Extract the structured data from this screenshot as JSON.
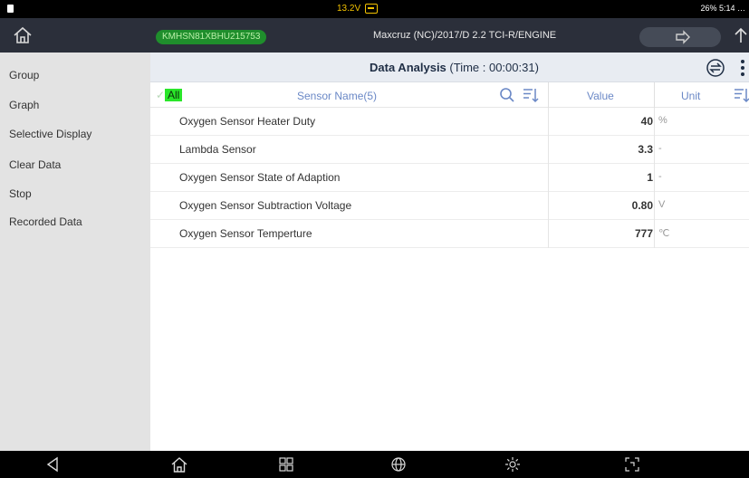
{
  "status_bar": {
    "voltage": "13.2V",
    "right_text": "26% 5:14 …"
  },
  "title_bar": {
    "vin": "KMHSN81XBHU215753",
    "vehicle": "Maxcruz (NC)/2017/D 2.2 TCI-R/ENGINE"
  },
  "sidebar": {
    "items": [
      {
        "label": "Group"
      },
      {
        "label": "Graph"
      },
      {
        "label": "Selective Display"
      },
      {
        "label": "Clear Data"
      },
      {
        "label": "Stop"
      },
      {
        "label": "Recorded Data"
      }
    ]
  },
  "panel": {
    "title": "Data Analysis",
    "time": "(Time : 00:00:31)"
  },
  "table": {
    "check_all_label": "All",
    "headers": {
      "name": "Sensor Name(5)",
      "value": "Value",
      "unit": "Unit"
    },
    "rows": [
      {
        "name": "Oxygen Sensor Heater Duty",
        "value": "40",
        "unit": "%"
      },
      {
        "name": "Lambda Sensor",
        "value": "3.3",
        "unit": "-"
      },
      {
        "name": "Oxygen Sensor State of Adaption",
        "value": "1",
        "unit": "-"
      },
      {
        "name": "Oxygen Sensor Subtraction Voltage",
        "value": "0.80",
        "unit": "V"
      },
      {
        "name": "Oxygen Sensor Temperture",
        "value": "777",
        "unit": "℃"
      }
    ]
  },
  "icons": {
    "home": "home-icon",
    "next": "arrow-right-icon",
    "upload": "upload-icon",
    "swap": "swap-icon",
    "menu": "more-vertical-icon",
    "search": "search-icon",
    "sort": "sort-icon",
    "nav_back": "back-icon",
    "nav_home": "home-icon",
    "nav_apps": "apps-icon",
    "nav_browser": "globe-icon",
    "nav_settings": "settings-icon",
    "nav_screenshot": "screenshot-icon"
  },
  "colors": {
    "vin_pill": "#1f8e2c",
    "check_all": "#29e629",
    "voltage": "#f2c200",
    "header_text": "#6a88c6"
  }
}
